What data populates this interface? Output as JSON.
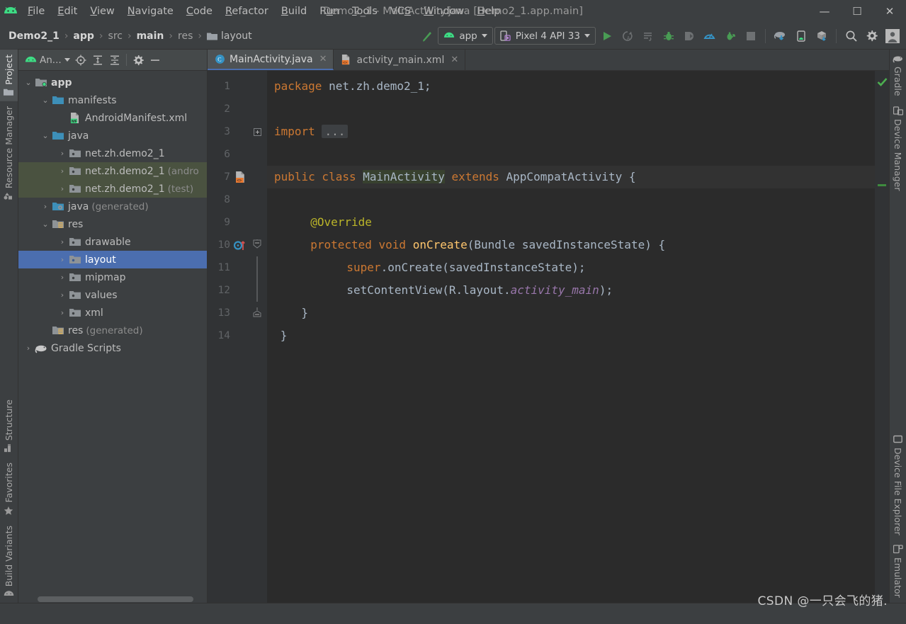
{
  "window": {
    "title": "Demo2_1 - MainActivity.java [Demo2_1.app.main]",
    "minimize": "—",
    "maximize": "☐",
    "close": "✕"
  },
  "menu": {
    "items": [
      {
        "pre": "",
        "mnem": "F",
        "post": "ile"
      },
      {
        "pre": "",
        "mnem": "E",
        "post": "dit"
      },
      {
        "pre": "",
        "mnem": "V",
        "post": "iew"
      },
      {
        "pre": "",
        "mnem": "N",
        "post": "avigate"
      },
      {
        "pre": "",
        "mnem": "C",
        "post": "ode"
      },
      {
        "pre": "",
        "mnem": "R",
        "post": "efactor"
      },
      {
        "pre": "",
        "mnem": "B",
        "post": "uild"
      },
      {
        "pre": "R",
        "mnem": "u",
        "post": "n"
      },
      {
        "pre": "",
        "mnem": "T",
        "post": "ools"
      },
      {
        "pre": "VC",
        "mnem": "S",
        "post": ""
      },
      {
        "pre": "",
        "mnem": "W",
        "post": "indow"
      },
      {
        "pre": "",
        "mnem": "H",
        "post": "elp"
      }
    ]
  },
  "breadcrumb": {
    "items": [
      {
        "label": "Demo2_1",
        "bold": true
      },
      {
        "label": "app",
        "bold": true
      },
      {
        "label": "src",
        "bold": false
      },
      {
        "label": "main",
        "bold": true
      },
      {
        "label": "res",
        "bold": false
      },
      {
        "label": "layout",
        "bold": false,
        "folder": true
      }
    ],
    "separator": "›"
  },
  "toolbar": {
    "run_config": "app",
    "device": "Pixel 4 API 33",
    "icons": [
      "make-project-icon",
      "run-icon",
      "apply-changes-icon",
      "apply-code-changes-icon",
      "debug-icon",
      "attach-debugger-icon",
      "profiler-icon",
      "run-with-coverage-icon",
      "stop-icon",
      "sync-gradle-icon",
      "avd-manager-icon",
      "sdk-manager-icon",
      "search-everywhere-icon",
      "settings-icon",
      "account-icon"
    ]
  },
  "left_strip": {
    "tabs": [
      {
        "label": "Project",
        "icon": "folder-icon",
        "selected": true
      },
      {
        "label": "Resource Manager",
        "icon": "resource-icon",
        "selected": false
      }
    ],
    "bottom_tabs": [
      {
        "label": "Structure",
        "icon": "structure-icon"
      },
      {
        "label": "Favorites",
        "icon": "star-icon"
      },
      {
        "label": "Build Variants",
        "icon": "android-icon"
      }
    ]
  },
  "right_strip": {
    "tabs": [
      {
        "label": "Gradle",
        "icon": "gradle-elephant-icon"
      },
      {
        "label": "Device Manager",
        "icon": "device-manager-icon"
      }
    ],
    "bottom_tabs": [
      {
        "label": "Device File Explorer",
        "icon": "device-file-icon"
      },
      {
        "label": "Emulator",
        "icon": "emulator-icon"
      }
    ]
  },
  "project_panel": {
    "title": "An...",
    "header_icons": [
      "select-opened-file-icon",
      "expand-all-icon",
      "collapse-all-icon",
      "settings-icon",
      "hide-icon"
    ],
    "tree": [
      {
        "indent": 0,
        "arrow": "down",
        "icon": "module-folder-icon",
        "label": "app",
        "suffix": "",
        "bold": true,
        "state": "normal"
      },
      {
        "indent": 1,
        "arrow": "down",
        "icon": "folder-blue-icon",
        "label": "manifests",
        "suffix": "",
        "bold": false,
        "state": "normal"
      },
      {
        "indent": 2,
        "arrow": "none",
        "icon": "manifest-file-icon",
        "label": "AndroidManifest.xml",
        "suffix": "",
        "bold": false,
        "state": "normal"
      },
      {
        "indent": 1,
        "arrow": "down",
        "icon": "folder-blue-icon",
        "label": "java",
        "suffix": "",
        "bold": false,
        "state": "normal"
      },
      {
        "indent": 2,
        "arrow": "right",
        "icon": "package-icon",
        "label": "net.zh.demo2_1",
        "suffix": "",
        "bold": false,
        "state": "normal"
      },
      {
        "indent": 2,
        "arrow": "right",
        "icon": "package-icon",
        "label": "net.zh.demo2_1",
        "suffix": "(andro",
        "bold": false,
        "state": "hl"
      },
      {
        "indent": 2,
        "arrow": "right",
        "icon": "package-icon",
        "label": "net.zh.demo2_1",
        "suffix": "(test)",
        "bold": false,
        "state": "hl"
      },
      {
        "indent": 1,
        "arrow": "right",
        "icon": "folder-generated-icon",
        "label": "java",
        "suffix": "(generated)",
        "bold": false,
        "state": "normal"
      },
      {
        "indent": 1,
        "arrow": "down",
        "icon": "res-folder-icon",
        "label": "res",
        "suffix": "",
        "bold": false,
        "state": "normal"
      },
      {
        "indent": 2,
        "arrow": "right",
        "icon": "package-icon",
        "label": "drawable",
        "suffix": "",
        "bold": false,
        "state": "normal"
      },
      {
        "indent": 2,
        "arrow": "right",
        "icon": "package-icon",
        "label": "layout",
        "suffix": "",
        "bold": false,
        "state": "selected"
      },
      {
        "indent": 2,
        "arrow": "right",
        "icon": "package-icon",
        "label": "mipmap",
        "suffix": "",
        "bold": false,
        "state": "normal"
      },
      {
        "indent": 2,
        "arrow": "right",
        "icon": "package-icon",
        "label": "values",
        "suffix": "",
        "bold": false,
        "state": "normal"
      },
      {
        "indent": 2,
        "arrow": "right",
        "icon": "package-icon",
        "label": "xml",
        "suffix": "",
        "bold": false,
        "state": "normal"
      },
      {
        "indent": 1,
        "arrow": "none",
        "icon": "res-folder-icon",
        "label": "res",
        "suffix": "(generated)",
        "bold": false,
        "state": "normal"
      },
      {
        "indent": 0,
        "arrow": "right",
        "icon": "gradle-elephant-icon",
        "label": "Gradle Scripts",
        "suffix": "",
        "bold": false,
        "state": "normal"
      }
    ]
  },
  "editor": {
    "tabs": [
      {
        "label": "MainActivity.java",
        "icon": "java-class-icon",
        "active": true,
        "close": "✕"
      },
      {
        "label": "activity_main.xml",
        "icon": "android-xml-icon",
        "active": false,
        "close": "✕"
      }
    ],
    "lines": [
      {
        "num": "1",
        "marker": "",
        "fold": "",
        "highlight": false
      },
      {
        "num": "2",
        "marker": "",
        "fold": "",
        "highlight": false
      },
      {
        "num": "3",
        "marker": "",
        "fold": "plus",
        "highlight": false
      },
      {
        "num": "6",
        "marker": "",
        "fold": "",
        "highlight": false
      },
      {
        "num": "7",
        "marker": "android-xml-icon",
        "fold": "",
        "highlight": true
      },
      {
        "num": "8",
        "marker": "",
        "fold": "",
        "highlight": false
      },
      {
        "num": "9",
        "marker": "",
        "fold": "",
        "highlight": false
      },
      {
        "num": "10",
        "marker": "override-icon",
        "fold": "minus-top",
        "highlight": false
      },
      {
        "num": "11",
        "marker": "",
        "fold": "bar",
        "highlight": false
      },
      {
        "num": "12",
        "marker": "",
        "fold": "bar",
        "highlight": false
      },
      {
        "num": "13",
        "marker": "",
        "fold": "minus-bottom",
        "highlight": false
      },
      {
        "num": "14",
        "marker": "",
        "fold": "",
        "highlight": false
      }
    ],
    "code": {
      "l1_kw": "package",
      "l1_rest": " net.zh.demo2_1;",
      "l3_kw": "import",
      "l3_fold": "...",
      "l7_a": "public class ",
      "l7_cls": "MainActivity",
      "l7_b": " extends ",
      "l7_super": "AppCompatActivity",
      "l7_c": " {",
      "l9_ann": "@Override",
      "l10_kw": "protected void ",
      "l10_meth": "onCreate",
      "l10_rest": "(Bundle savedInstanceState) {",
      "l11_a": "super",
      "l11_b": ".onCreate(savedInstanceState);",
      "l12_a": "setContentView(R.layout.",
      "l12_field": "activity_main",
      "l12_b": ");",
      "l13": "}",
      "l14": "}"
    },
    "indicators": {
      "inspection_status": "ok-checkmark"
    }
  },
  "watermark": "CSDN @一只会飞的猪."
}
